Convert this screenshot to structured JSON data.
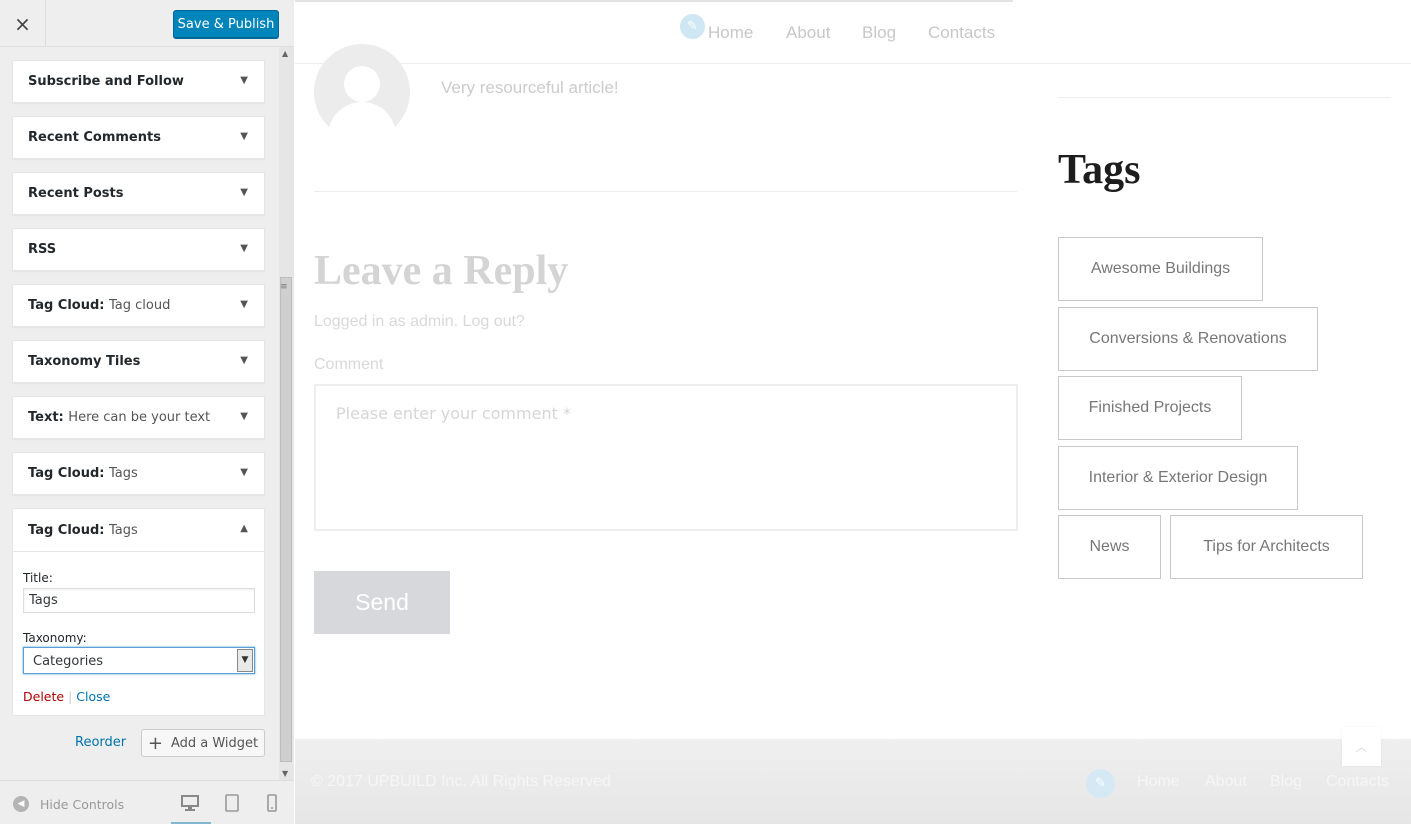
{
  "sidebar": {
    "close_label": "×",
    "publish_label": "Save & Publish",
    "widgets": [
      {
        "title": "Subscribe and Follow",
        "subtitle": ""
      },
      {
        "title": "Recent Comments",
        "subtitle": ""
      },
      {
        "title": "Recent Posts",
        "subtitle": ""
      },
      {
        "title": "RSS",
        "subtitle": ""
      },
      {
        "title": "Tag Cloud:",
        "subtitle": "Tag cloud"
      },
      {
        "title": "Taxonomy Tiles",
        "subtitle": ""
      },
      {
        "title": "Text:",
        "subtitle": "Here can be your text"
      },
      {
        "title": "Tag Cloud:",
        "subtitle": "Tags"
      }
    ],
    "open_widget": {
      "title": "Tag Cloud:",
      "subtitle": "Tags",
      "title_label": "Title:",
      "title_value": "Tags",
      "taxonomy_label": "Taxonomy:",
      "taxonomy_value": "Categories",
      "delete_label": "Delete",
      "separator": "|",
      "close_label": "Close"
    },
    "reorder_label": "Reorder",
    "add_widget_label": "Add a Widget",
    "footer": {
      "hide_controls_label": "Hide Controls"
    }
  },
  "preview": {
    "nav": [
      "Home",
      "About",
      "Blog",
      "Contacts"
    ],
    "comment_text": "Very resourceful article!",
    "reply_title": "Leave a Reply",
    "logged_in_text": "Logged in as admin. Log out?",
    "comment_label": "Comment",
    "comment_placeholder": "Please enter your comment *",
    "send_label": "Send",
    "tags_heading": "Tags",
    "tags": [
      "Awesome Buildings",
      "Conversions & Renovations",
      "Finished Projects",
      "Interior & Exterior Design",
      "News",
      "Tips for Architects"
    ],
    "footer_copyright": "© 2017 UPBUILD Inc. All Rights Reserved",
    "footer_nav": [
      "Home",
      "About",
      "Blog",
      "Contacts"
    ]
  },
  "colors": {
    "accent": "#0085ba",
    "link": "#0073aa",
    "delete": "#aa0000"
  }
}
